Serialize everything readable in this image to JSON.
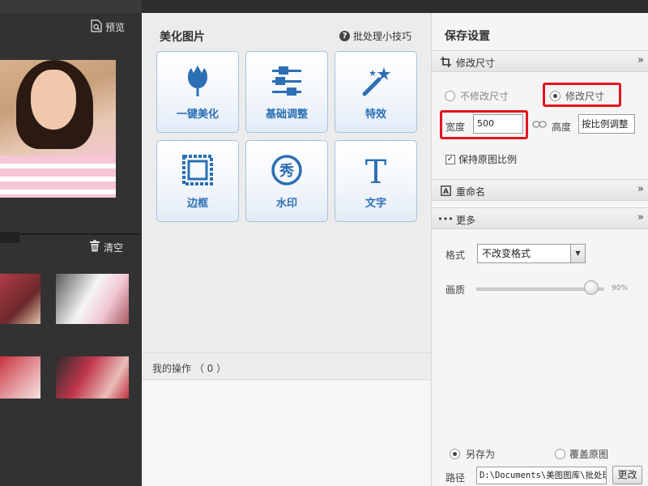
{
  "left_panel": {
    "preview_label": "预览",
    "clear_label": "清空"
  },
  "tools_panel": {
    "title": "美化图片",
    "tips_link": "批处理小技巧",
    "tools": [
      {
        "label": "一键美化",
        "icon": "tulip-icon"
      },
      {
        "label": "基础调整",
        "icon": "sliders-icon"
      },
      {
        "label": "特效",
        "icon": "magic-wand-icon"
      },
      {
        "label": "边框",
        "icon": "frame-icon"
      },
      {
        "label": "水印",
        "icon": "watermark-icon"
      },
      {
        "label": "文字",
        "icon": "text-icon"
      }
    ],
    "operations_label": "我的操作 （ 0 ）"
  },
  "save_panel": {
    "title": "保存设置",
    "resize_section": "修改尺寸",
    "no_resize_option": "不修改尺寸",
    "resize_option": "修改尺寸",
    "width_label": "宽度",
    "width_value": "500",
    "height_label": "高度",
    "height_value": "按比例调整",
    "keep_ratio_label": "保持原图比例",
    "keep_ratio_checked": true,
    "rename_section": "重命名",
    "more_section": "更多",
    "format_label": "格式",
    "format_value": "不改变格式",
    "quality_label": "画质",
    "quality_value": "90%",
    "quality_percent": 90,
    "save_as_label": "另存为",
    "overwrite_label": "覆盖原图",
    "path_label": "路径",
    "path_value": "D:\\Documents\\美图图库\\批处理",
    "change_button": "更改"
  },
  "colors": {
    "accent_blue": "#2b6fb4",
    "highlight_red": "#e2141e"
  }
}
